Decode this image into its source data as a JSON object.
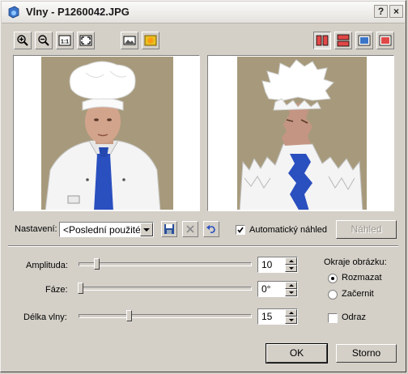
{
  "window": {
    "title": "Vlny - P1260042.JPG"
  },
  "toolbar": {
    "left_tools": [
      "zoom-in-icon",
      "zoom-out-icon",
      "actual-size-icon",
      "fit-to-window-icon",
      "compare-original-icon",
      "sun-preview-icon"
    ],
    "right_tools": [
      "split-vertical-icon",
      "split-horizontal-icon",
      "single-blue-icon",
      "single-red-icon"
    ]
  },
  "settings": {
    "label": "Nastavení:",
    "preset_value": "<Poslední použité>",
    "auto_preview_label": "Automatický náhled",
    "auto_preview_checked": true,
    "preview_button": "Náhled"
  },
  "params": {
    "amplitude": {
      "label": "Amplituda:",
      "value": "10",
      "level": 0.1
    },
    "phase": {
      "label": "Fáze:",
      "value": "0°",
      "level": 0.0
    },
    "wavelength": {
      "label": "Délka vlny:",
      "value": "15",
      "level": 0.28
    }
  },
  "edges": {
    "label": "Okraje obrázku:",
    "options": [
      "Rozmazat",
      "Začernit"
    ],
    "selected": "Rozmazat",
    "reflect_label": "Odraz",
    "reflect_checked": false
  },
  "buttons": {
    "ok": "OK",
    "cancel": "Storno"
  },
  "colors": {
    "accent_blue": "#2a5aa8",
    "window_bg": "#d4d0c8"
  }
}
